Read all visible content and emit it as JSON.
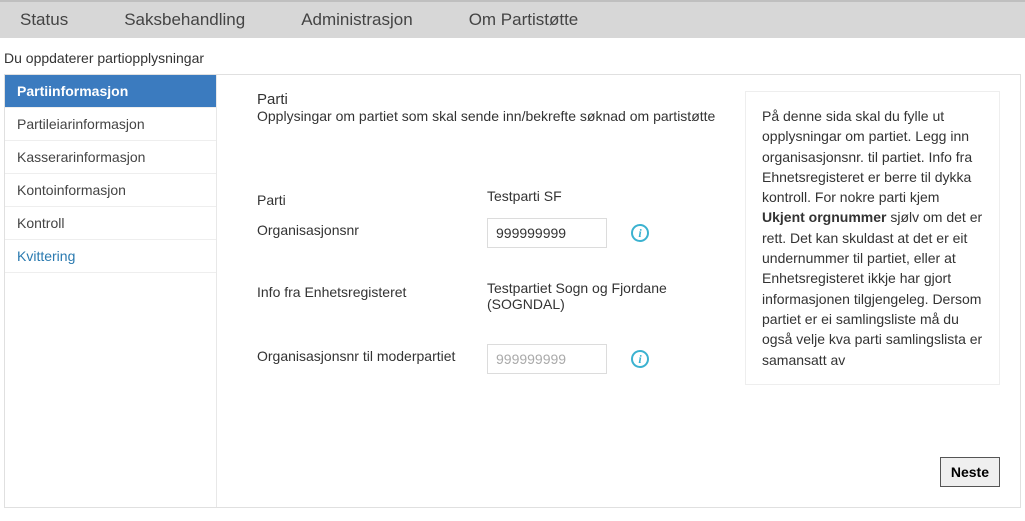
{
  "nav": {
    "items": [
      "Status",
      "Saksbehandling",
      "Administrasjon",
      "Om Partistøtte"
    ]
  },
  "breadcrumb": "Du oppdaterer partiopplysningar",
  "sidebar": {
    "items": [
      {
        "label": "Partiinformasjon"
      },
      {
        "label": "Partileiarinformasjon"
      },
      {
        "label": "Kasserarinformasjon"
      },
      {
        "label": "Kontoinformasjon"
      },
      {
        "label": "Kontroll"
      },
      {
        "label": "Kvittering"
      }
    ]
  },
  "section": {
    "title": "Parti",
    "subtitle": "Opplysingar om partiet som skal sende inn/bekrefte søknad om partistøtte"
  },
  "form": {
    "party_label": "Parti",
    "party_value": "Testparti SF",
    "orgnr_label": "Organisasjonsnr",
    "orgnr_value": "999999999",
    "enreg_label": "Info fra Enhetsregisteret",
    "enreg_value": "Testpartiet Sogn og Fjordane (SOGNDAL)",
    "parent_orgnr_label": "Organisasjonsnr til moderpartiet",
    "parent_orgnr_placeholder": "999999999"
  },
  "help": {
    "text1": "På denne sida skal du fylle ut opplysningar om partiet. Legg inn organisasjonsnr. til partiet. Info fra Ehnetsregisteret er berre til dykka kontroll. For nokre parti kjem ",
    "bold": "Ukjent orgnummer",
    "text2": " sjølv om det er rett. Det kan skuldast at det er eit undernummer til partiet, eller at Enhetsregisteret ikkje har gjort informasjonen tilgjengeleg. Dersom partiet er ei samlingsliste må du også velje kva parti samlingslista er samansatt av"
  },
  "buttons": {
    "next": "Neste"
  }
}
